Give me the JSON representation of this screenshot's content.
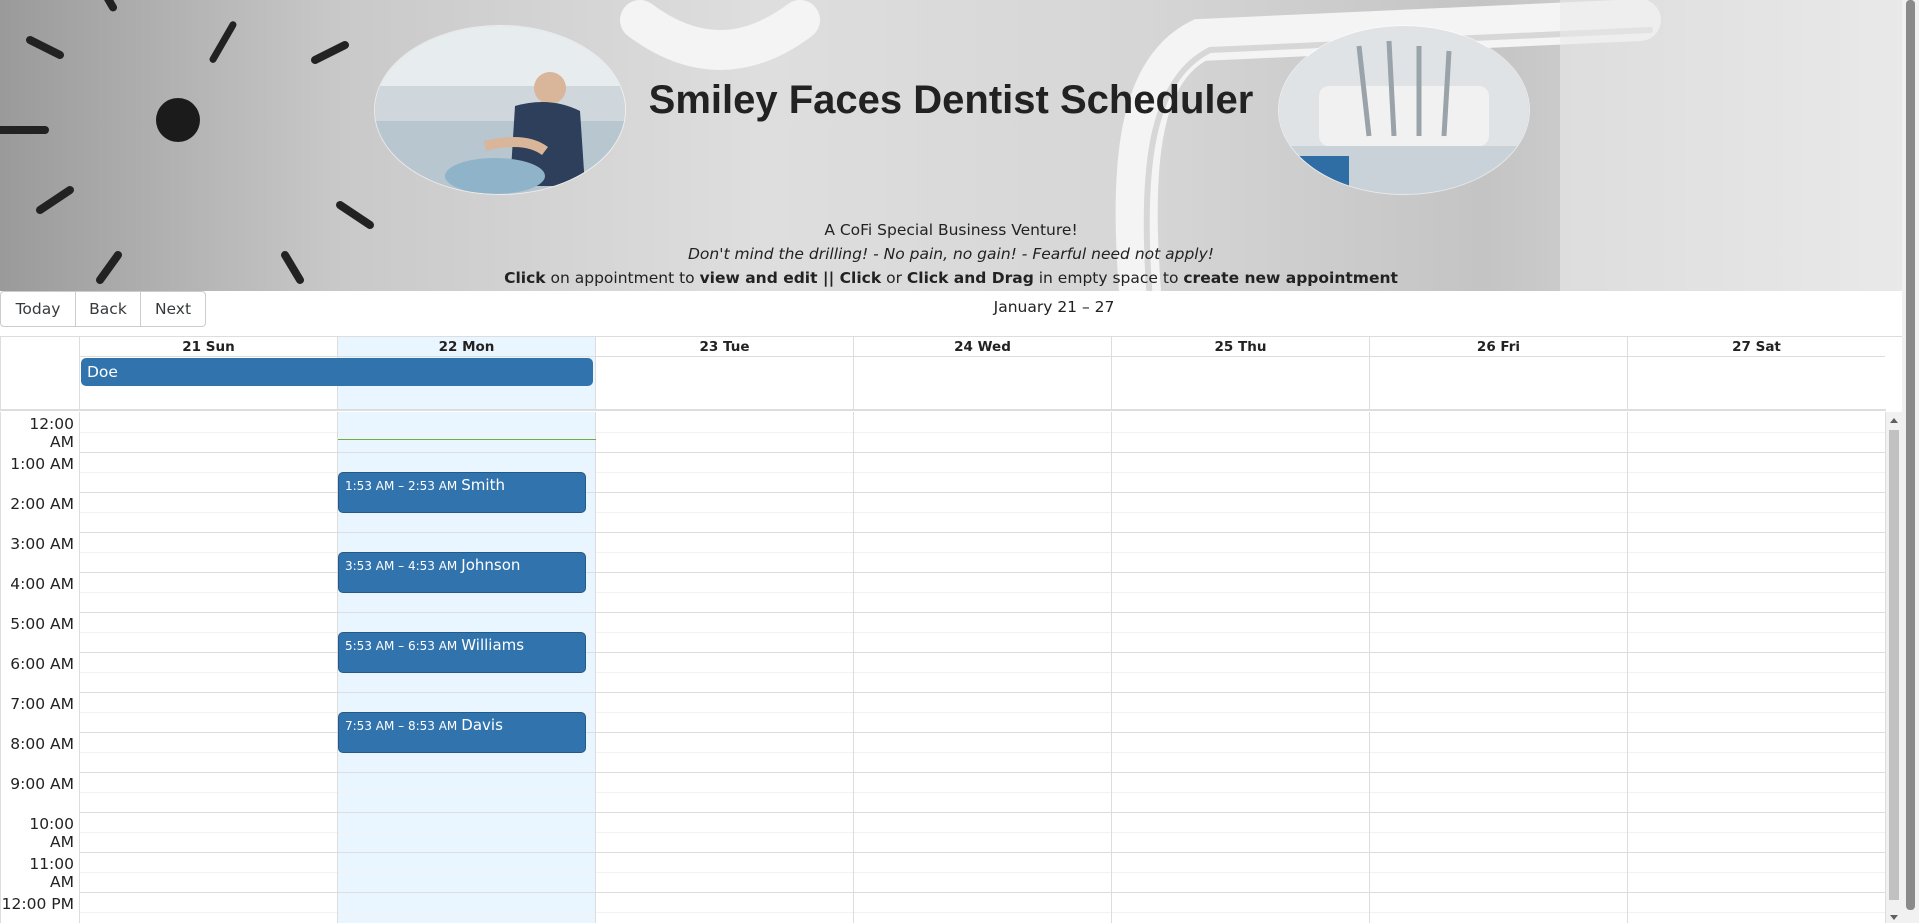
{
  "header": {
    "title": "Smiley Faces Dentist Scheduler",
    "tagline1": "A CoFi Special Business Venture!",
    "tagline2": "Don't mind the drilling! - No pain, no gain! - Fearful need not apply!",
    "instructions": {
      "click1": "Click",
      "t1": " on appointment to ",
      "view_edit": "view and edit",
      "sep": " || ",
      "click2": "Click",
      "t2": " or ",
      "click_drag": "Click and Drag",
      "t3": " in empty space to ",
      "create": "create new appointment"
    }
  },
  "toolbar": {
    "today_label": "Today",
    "back_label": "Back",
    "next_label": "Next",
    "range_label": "January 21 – 27"
  },
  "calendar": {
    "days": [
      "21 Sun",
      "22 Mon",
      "23 Tue",
      "24 Wed",
      "25 Thu",
      "26 Fri",
      "27 Sat"
    ],
    "today_index": 1,
    "all_day_event": {
      "title": "Doe",
      "start_day": 0,
      "end_day": 1
    },
    "time_labels": [
      "12:00 AM",
      "1:00 AM",
      "2:00 AM",
      "3:00 AM",
      "4:00 AM",
      "5:00 AM",
      "6:00 AM",
      "7:00 AM",
      "8:00 AM",
      "9:00 AM",
      "10:00 AM",
      "11:00 AM",
      "12:00 PM"
    ],
    "appointments": [
      {
        "day": 1,
        "start_hour": 1.883,
        "time": "1:53 AM – 2:53 AM",
        "name": "Smith"
      },
      {
        "day": 1,
        "start_hour": 3.883,
        "time": "3:53 AM – 4:53 AM",
        "name": "Johnson"
      },
      {
        "day": 1,
        "start_hour": 5.883,
        "time": "5:53 AM – 6:53 AM",
        "name": "Williams"
      },
      {
        "day": 1,
        "start_hour": 7.883,
        "time": "7:53 AM – 8:53 AM",
        "name": "Davis"
      }
    ],
    "colors": {
      "event": "#3174ad",
      "today_bg": "#eaf6ff",
      "now_indicator": "#74ad31"
    }
  }
}
